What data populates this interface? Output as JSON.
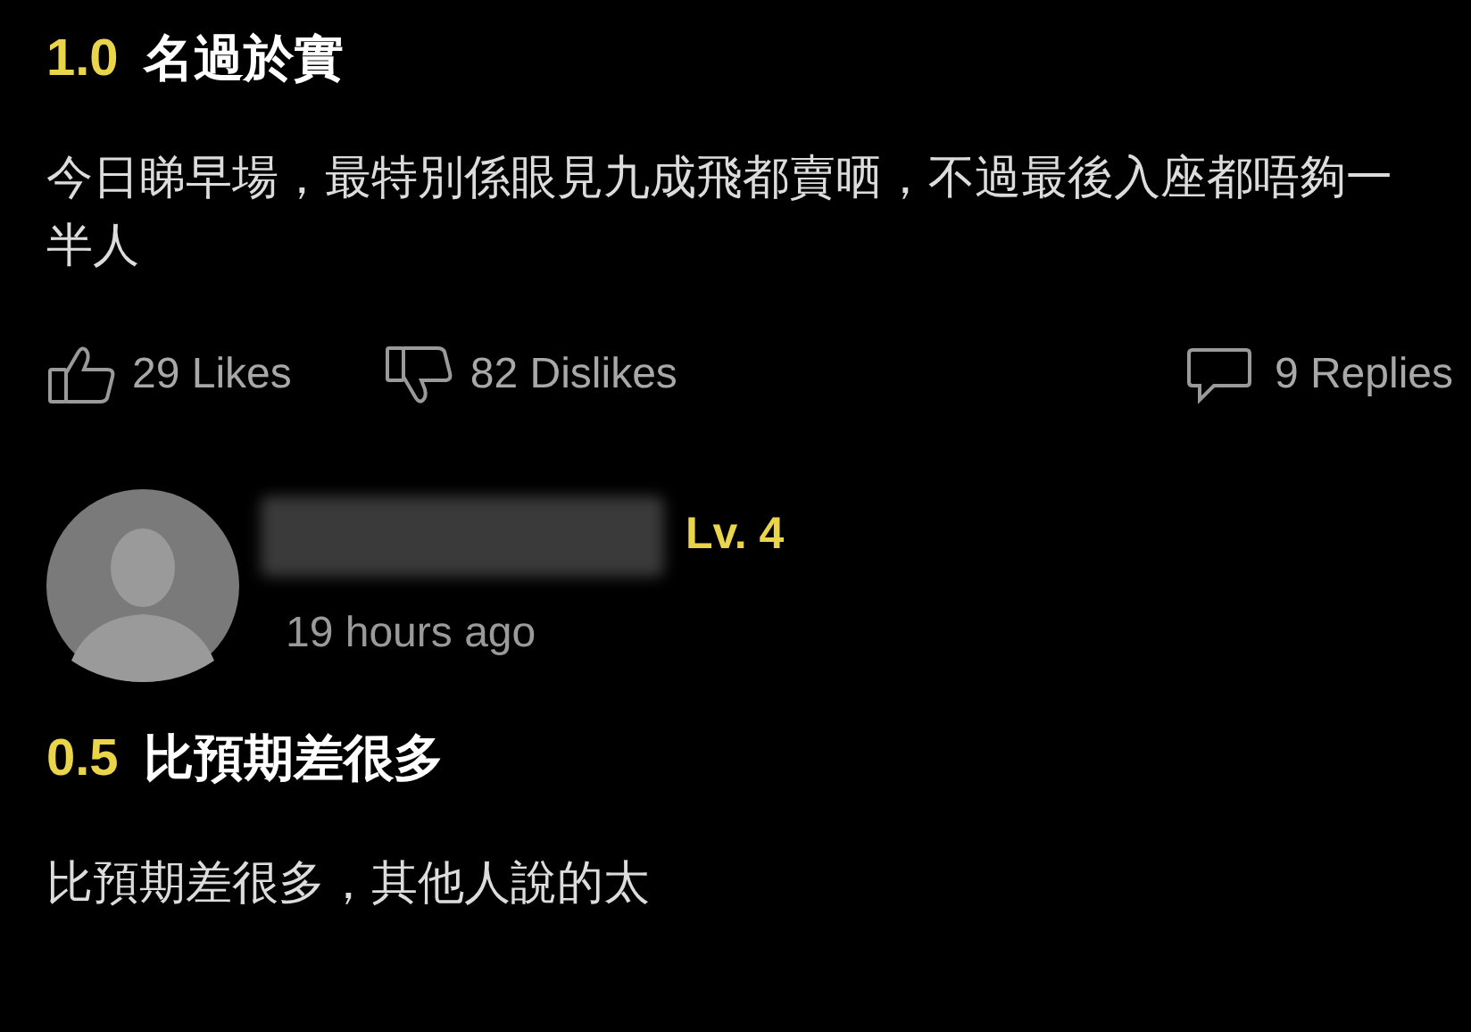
{
  "reviews": [
    {
      "score": "1.0",
      "title": "名過於實",
      "body": "今日睇早場，最特別係眼見九成飛都賣晒，不過最後入座都唔夠一半人",
      "likes": "29 Likes",
      "dislikes": "82 Dislikes",
      "replies": "9 Replies"
    },
    {
      "user": {
        "level": "Lv. 4",
        "time": "19 hours ago"
      },
      "score": "0.5",
      "title": "比預期差很多",
      "body": "比預期差很多，其他人說的太"
    }
  ]
}
